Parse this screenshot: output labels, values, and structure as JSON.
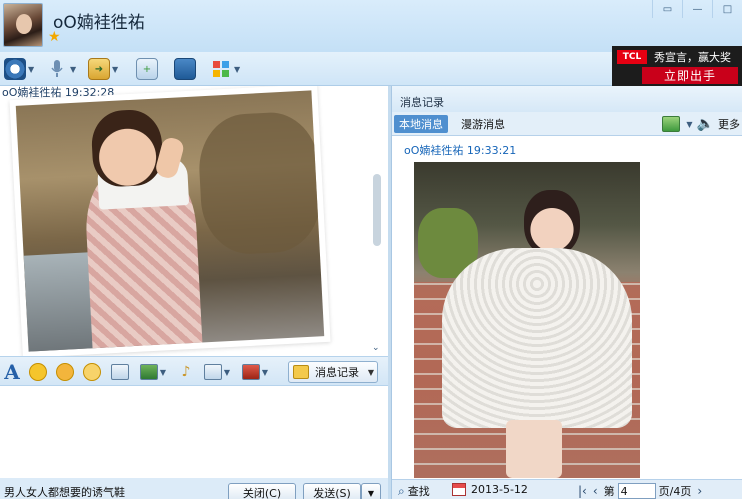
{
  "window": {
    "contact_name": "oO婻袿徃祐",
    "buttons": [
      "▭",
      "—",
      "□"
    ]
  },
  "ad_banner": {
    "brand": "TCL",
    "line1": "秀宣言，赢大奖",
    "line2": "立即出手"
  },
  "chat": {
    "last_sender_line": "oO婻袿徃祐  19:32:28"
  },
  "format_toolbar": {
    "font_glyph": "A",
    "message_record_label": "消息记录"
  },
  "bottom": {
    "ad_text": "男人女人都想要的诱气鞋",
    "close_label": "关闭(C)",
    "send_label": "发送(S)"
  },
  "history": {
    "title": "消息记录",
    "tabs": [
      {
        "label": "本地消息",
        "active": true
      },
      {
        "label": "漫游消息",
        "active": false
      }
    ],
    "more_label": "更多",
    "message_header": "oO婻袿徃祐  19:33:21",
    "search_label": "查找",
    "date": "2013-5-12",
    "page_prefix": "第",
    "page_value": "4",
    "page_suffix": "页/4页"
  },
  "colors": {
    "accent": "#4f8fcf",
    "sender_blue": "#1665b8",
    "ad_red": "#e60012"
  }
}
